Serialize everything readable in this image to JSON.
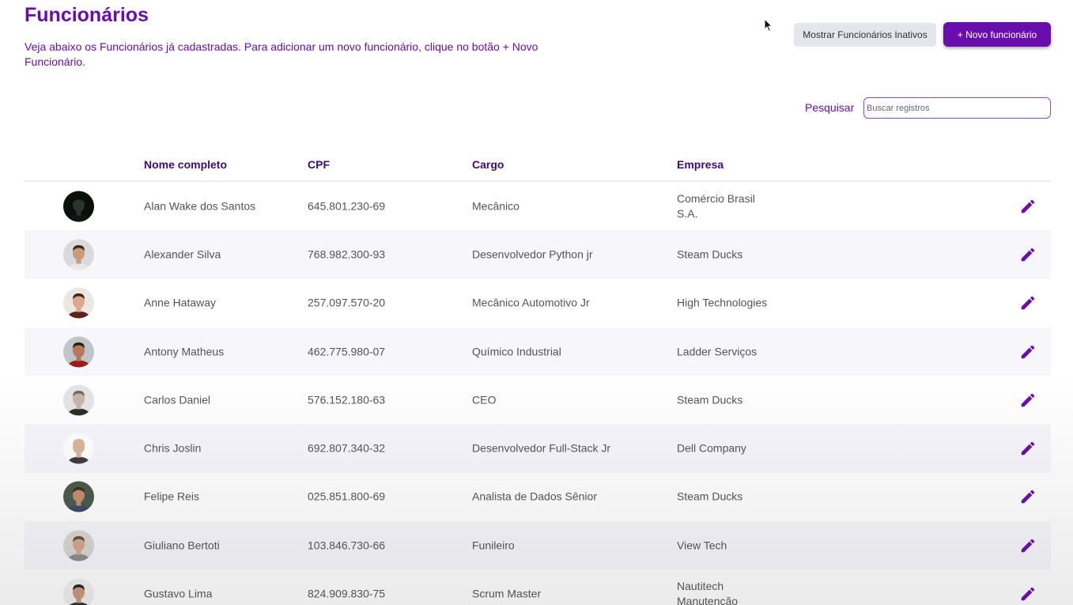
{
  "header": {
    "title": "Funcionários",
    "subtitle": "Veja abaixo os Funcionários já cadastradas. Para adicionar um novo funcionário, clique no botão + Novo Funcionário.",
    "show_inactive_label": "Mostrar Funcionários Inativos",
    "new_button_label": "+ Novo funcionário"
  },
  "search": {
    "label": "Pesquisar",
    "placeholder": "Buscar registros",
    "value": ""
  },
  "table": {
    "columns": [
      "Nome completo",
      "CPF",
      "Cargo",
      "Empresa"
    ],
    "rows": [
      {
        "name": "Alan Wake dos Santos",
        "cpf": "645.801.230-69",
        "cargo": "Mecânico",
        "empresa": "Comércio Brasil S.A."
      },
      {
        "name": "Alexander Silva",
        "cpf": "768.982.300-93",
        "cargo": "Desenvolvedor Python jr",
        "empresa": "Steam Ducks"
      },
      {
        "name": "Anne Hataway",
        "cpf": "257.097.570-20",
        "cargo": "Mecânico Automotivo Jr",
        "empresa": "High Technologies"
      },
      {
        "name": "Antony Matheus",
        "cpf": "462.775.980-07",
        "cargo": "Químico Industrial",
        "empresa": "Ladder Serviços"
      },
      {
        "name": "Carlos Daniel",
        "cpf": "576.152.180-63",
        "cargo": "CEO",
        "empresa": "Steam Ducks"
      },
      {
        "name": "Chris Joslin",
        "cpf": "692.807.340-32",
        "cargo": "Desenvolvedor Full-Stack Jr",
        "empresa": "Dell Company"
      },
      {
        "name": "Felipe Reis",
        "cpf": "025.851.800-69",
        "cargo": "Analista de Dados Sênior",
        "empresa": "Steam Ducks"
      },
      {
        "name": "Giuliano Bertoti",
        "cpf": "103.846.730-66",
        "cargo": "Funileiro",
        "empresa": "View Tech"
      },
      {
        "name": "Gustavo Lima",
        "cpf": "824.909.830-75",
        "cargo": "Scrum Master",
        "empresa": "Nautitech Manutenção"
      }
    ]
  },
  "theme": {
    "accent": "#6a0dad",
    "header_text": "#3d0a78",
    "row_alt_bg": "#f6f6fb"
  },
  "icons": {
    "row_action": "pencil-icon",
    "cursor": "mouse-pointer-icon"
  }
}
